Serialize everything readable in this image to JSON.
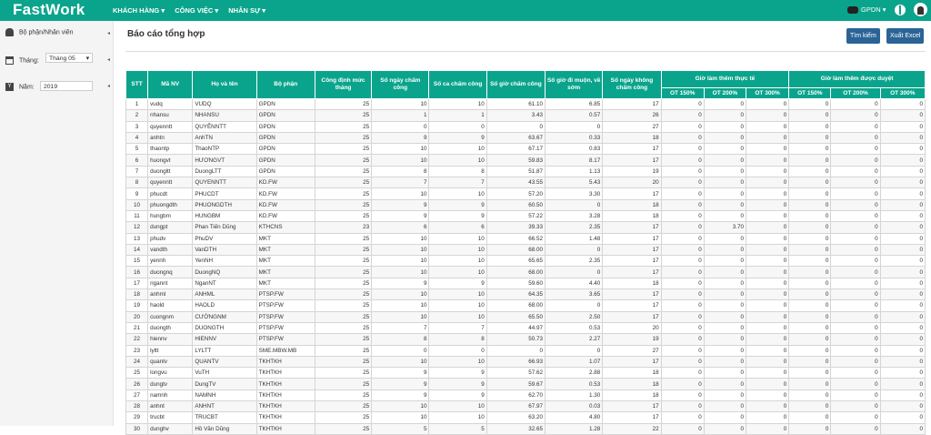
{
  "app": {
    "logo": "FastWork",
    "nav": [
      "KHÁCH HÀNG ▾",
      "CÔNG VIỆC ▾",
      "NHÂN SỰ ▾"
    ],
    "user": "GPDN ▾",
    "accent": "#0aa48c"
  },
  "sidebar": {
    "employee_label": "Bộ phận/Nhân viên",
    "month_label": "Tháng:",
    "month_value": "Tháng 05",
    "year_label": "Năm:",
    "year_value": "2019"
  },
  "page": {
    "title": "Báo cáo tổng hợp",
    "search_button": "Tìm kiếm",
    "export_button": "Xuất Excel"
  },
  "table": {
    "headers": {
      "stt": "STT",
      "ma": "Mã NV",
      "name": "Họ và tên",
      "dept": "Bộ phận",
      "cdm": "Công định mức tháng",
      "snc": "Số ngày chấm công",
      "sca": "Số ca chấm công",
      "sgio": "Số giờ chấm công",
      "dimuon": "Số giờ đi muộn, về sớm",
      "kcc": "Số ngày không chấm công",
      "ot_actual": "Giờ làm thêm thực tế",
      "ot_approved": "Giờ làm thêm được duyệt",
      "ot150": "OT 150%",
      "ot200": "OT 200%",
      "ot300": "OT 300%"
    },
    "rows": [
      [
        "1",
        "vudq",
        "VUDQ",
        "GPDN",
        "25",
        "10",
        "10",
        "61.10",
        "6.85",
        "17",
        "0",
        "0",
        "0",
        "0",
        "0",
        "0"
      ],
      [
        "2",
        "nhansu",
        "NHANSU",
        "GPDN",
        "25",
        "1",
        "1",
        "3.43",
        "0.57",
        "26",
        "0",
        "0",
        "0",
        "0",
        "0",
        "0"
      ],
      [
        "3",
        "quyenntt",
        "QUYÊNNTT",
        "GPDN",
        "25",
        "0",
        "0",
        "0",
        "0",
        "27",
        "0",
        "0",
        "0",
        "0",
        "0",
        "0"
      ],
      [
        "4",
        "anhtn",
        "AnhTN",
        "GPDN",
        "25",
        "9",
        "9",
        "63.67",
        "0.33",
        "18",
        "0",
        "0",
        "0",
        "0",
        "0",
        "0"
      ],
      [
        "5",
        "thaontp",
        "ThaoNTP",
        "GPDN",
        "25",
        "10",
        "10",
        "67.17",
        "0.83",
        "17",
        "0",
        "0",
        "0",
        "0",
        "0",
        "0"
      ],
      [
        "6",
        "huongvt",
        "HƯƠNGVT",
        "GPDN",
        "25",
        "10",
        "10",
        "59.83",
        "8.17",
        "17",
        "0",
        "0",
        "0",
        "0",
        "0",
        "0"
      ],
      [
        "7",
        "duongltt",
        "DuongLTT",
        "GPDN",
        "25",
        "8",
        "8",
        "51.87",
        "1.13",
        "19",
        "0",
        "0",
        "0",
        "0",
        "0",
        "0"
      ],
      [
        "8",
        "quyenntt",
        "QUYENNTT",
        "KD.FW",
        "25",
        "7",
        "7",
        "43.55",
        "5.43",
        "20",
        "0",
        "0",
        "0",
        "0",
        "0",
        "0"
      ],
      [
        "9",
        "phucdt",
        "PHUCDT",
        "KD.FW",
        "25",
        "10",
        "10",
        "57.20",
        "3.30",
        "17",
        "0",
        "0",
        "0",
        "0",
        "0",
        "0"
      ],
      [
        "10",
        "phuongdth",
        "PHUONGDTH",
        "KD.FW",
        "25",
        "9",
        "9",
        "60.50",
        "0",
        "18",
        "0",
        "0",
        "0",
        "0",
        "0",
        "0"
      ],
      [
        "11",
        "hungbm",
        "HUNGBM",
        "KD.FW",
        "25",
        "9",
        "9",
        "57.22",
        "3.28",
        "18",
        "0",
        "0",
        "0",
        "0",
        "0",
        "0"
      ],
      [
        "12",
        "dungpt",
        "Phan Tiến Dũng",
        "KTHCNS",
        "23",
        "6",
        "6",
        "39.33",
        "2.35",
        "17",
        "0",
        "3.70",
        "0",
        "0",
        "0",
        "0"
      ],
      [
        "13",
        "phudv",
        "PhuDV",
        "MKT",
        "25",
        "10",
        "10",
        "66.52",
        "1.48",
        "17",
        "0",
        "0",
        "0",
        "0",
        "0",
        "0"
      ],
      [
        "14",
        "vandth",
        "VanDTH",
        "MKT",
        "25",
        "10",
        "10",
        "68.00",
        "0",
        "17",
        "0",
        "0",
        "0",
        "0",
        "0",
        "0"
      ],
      [
        "15",
        "yennh",
        "YenNH",
        "MKT",
        "25",
        "10",
        "10",
        "65.65",
        "2.35",
        "17",
        "0",
        "0",
        "0",
        "0",
        "0",
        "0"
      ],
      [
        "16",
        "duongnq",
        "DuongNQ",
        "MKT",
        "25",
        "10",
        "10",
        "68.00",
        "0",
        "17",
        "0",
        "0",
        "0",
        "0",
        "0",
        "0"
      ],
      [
        "17",
        "ngannt",
        "NganNT",
        "MKT",
        "25",
        "9",
        "9",
        "59.60",
        "4.40",
        "18",
        "0",
        "0",
        "0",
        "0",
        "0",
        "0"
      ],
      [
        "18",
        "anhml",
        "ANHML",
        "PTSP.FW",
        "25",
        "10",
        "10",
        "64.35",
        "3.65",
        "17",
        "0",
        "0",
        "0",
        "0",
        "0",
        "0"
      ],
      [
        "19",
        "haold",
        "HAOLD",
        "PTSP.FW",
        "25",
        "10",
        "10",
        "68.00",
        "0",
        "17",
        "0",
        "0",
        "0",
        "0",
        "0",
        "0"
      ],
      [
        "20",
        "cuongnm",
        "CƯỜNGNM",
        "PTSP.FW",
        "25",
        "10",
        "10",
        "65.50",
        "2.50",
        "17",
        "0",
        "0",
        "0",
        "0",
        "0",
        "0"
      ],
      [
        "21",
        "duongth",
        "DUONGTH",
        "PTSP.FW",
        "25",
        "7",
        "7",
        "44.97",
        "0.53",
        "20",
        "0",
        "0",
        "0",
        "0",
        "0",
        "0"
      ],
      [
        "22",
        "hiennv",
        "HIENNV",
        "PTSP.FW",
        "25",
        "8",
        "8",
        "50.73",
        "2.27",
        "19",
        "0",
        "0",
        "0",
        "0",
        "0",
        "0"
      ],
      [
        "23",
        "lyltt",
        "LYLTT",
        "SME.MBW.MB",
        "25",
        "0",
        "0",
        "0",
        "0",
        "27",
        "0",
        "0",
        "0",
        "0",
        "0",
        "0"
      ],
      [
        "24",
        "quantv",
        "QUANTV",
        "TKHTKH",
        "25",
        "10",
        "10",
        "66.93",
        "1.07",
        "17",
        "0",
        "0",
        "0",
        "0",
        "0",
        "0"
      ],
      [
        "25",
        "longvu",
        "VuTH",
        "TKHTKH",
        "25",
        "9",
        "9",
        "57.62",
        "2.88",
        "18",
        "0",
        "0",
        "0",
        "0",
        "0",
        "0"
      ],
      [
        "26",
        "dungtv",
        "DungTV",
        "TKHTKH",
        "25",
        "9",
        "9",
        "59.67",
        "0.53",
        "18",
        "0",
        "0",
        "0",
        "0",
        "0",
        "0"
      ],
      [
        "27",
        "namnh",
        "NAMNH",
        "TKHTKH",
        "25",
        "9",
        "9",
        "62.70",
        "1.30",
        "18",
        "0",
        "0",
        "0",
        "0",
        "0",
        "0"
      ],
      [
        "28",
        "anhnt",
        "ANHNT",
        "TKHTKH",
        "25",
        "10",
        "10",
        "67.97",
        "0.03",
        "17",
        "0",
        "0",
        "0",
        "0",
        "0",
        "0"
      ],
      [
        "29",
        "trucbt",
        "TRUCBT",
        "TKHTKH",
        "25",
        "10",
        "10",
        "63.20",
        "4.80",
        "17",
        "0",
        "0",
        "0",
        "0",
        "0",
        "0"
      ],
      [
        "30",
        "dunghv",
        "Hồ Văn Dũng",
        "TKHTKH",
        "25",
        "5",
        "5",
        "32.65",
        "1.28",
        "22",
        "0",
        "0",
        "0",
        "0",
        "0",
        "0"
      ]
    ]
  }
}
